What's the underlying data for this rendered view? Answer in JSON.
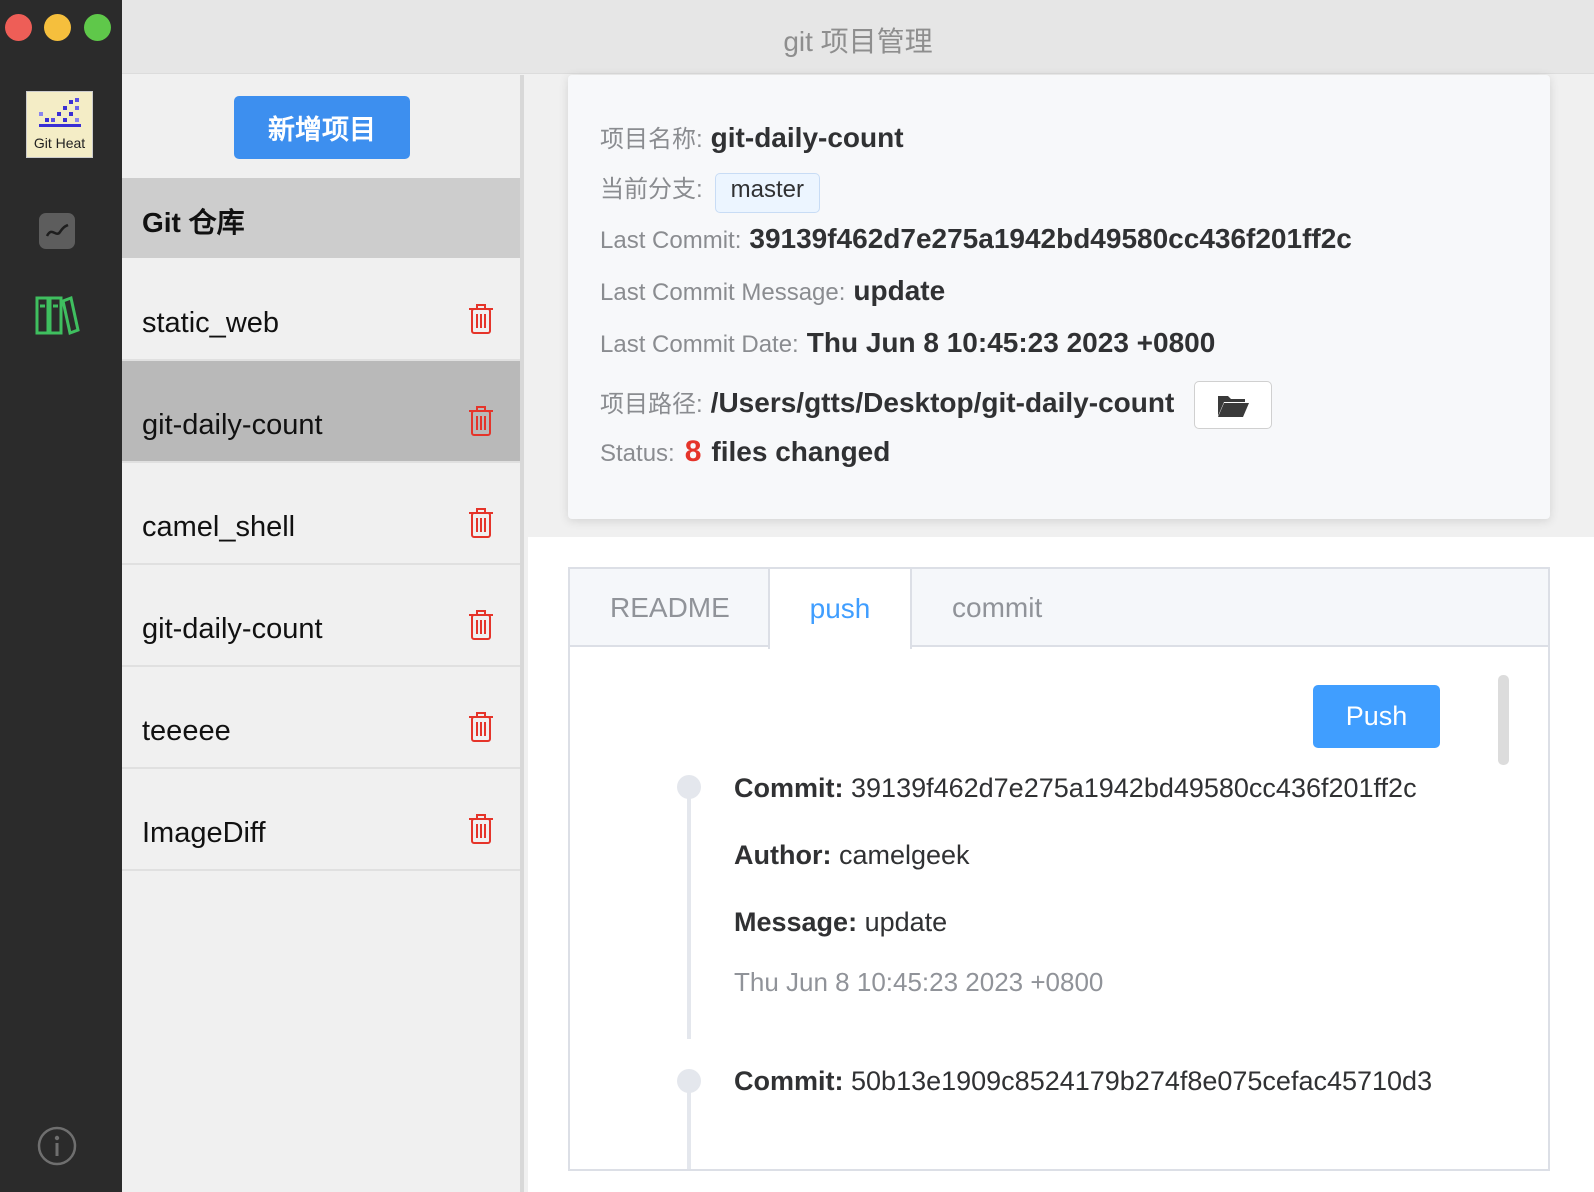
{
  "window": {
    "title": "git 项目管理"
  },
  "rail": {
    "app_icon_label": "Git Heat",
    "items": [
      {
        "icon": "chart-icon"
      },
      {
        "icon": "books-icon"
      },
      {
        "icon": "info-icon"
      }
    ]
  },
  "sidebar": {
    "add_button_label": "新增项目",
    "section_title": "Git 仓库",
    "projects": [
      {
        "name": "static_web"
      },
      {
        "name": "git-daily-count"
      },
      {
        "name": "camel_shell"
      },
      {
        "name": "git-daily-count"
      },
      {
        "name": "teeeee"
      },
      {
        "name": "ImageDiff"
      }
    ],
    "active_index": 1
  },
  "info": {
    "name_label": "项目名称:",
    "name_value": "git-daily-count",
    "branch_label": "当前分支:",
    "branch_value": "master",
    "last_commit_label": "Last Commit:",
    "last_commit_value": "39139f462d7e275a1942bd49580cc436f201ff2c",
    "last_message_label": "Last Commit Message:",
    "last_message_value": "update",
    "last_date_label": "Last Commit Date:",
    "last_date_value": "Thu Jun 8 10:45:23 2023 +0800",
    "path_label": "项目路径:",
    "path_value": "/Users/gtts/Desktop/git-daily-count",
    "status_label": "Status:",
    "status_count": "8",
    "status_text": "files changed"
  },
  "tabs": {
    "items": [
      {
        "label": "README"
      },
      {
        "label": "push"
      },
      {
        "label": "commit"
      }
    ],
    "active": "push"
  },
  "push_panel": {
    "push_button_label": "Push",
    "commit_prefix": "Commit:",
    "author_prefix": "Author:",
    "message_prefix": "Message:",
    "commits": [
      {
        "hash": "39139f462d7e275a1942bd49580cc436f201ff2c",
        "author": "camelgeek",
        "message": "update",
        "date": "Thu Jun 8 10:45:23 2023 +0800"
      },
      {
        "hash": "50b13e1909c8524179b274f8e075cefac45710d3"
      }
    ]
  },
  "colors": {
    "primary": "#409eff",
    "rail_bg": "#2b2b2b",
    "delete_red": "#e5342a",
    "active_item": "#b9b9b9"
  }
}
